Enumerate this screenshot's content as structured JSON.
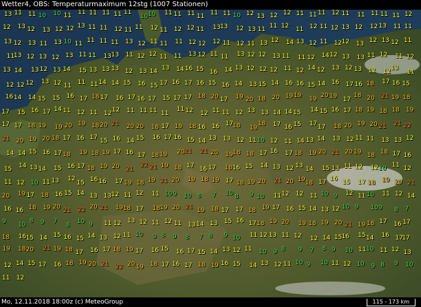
{
  "header": {
    "title": "Wetter4, OBS: Temperaturmaximum 12stg (1007 Stationen)"
  },
  "footer": {
    "text": "Mo, 12.11.2018 18:00z (c) MeteoGroup",
    "scale": "115 - 173 km"
  },
  "colors": {
    "warm": "#ffff33",
    "warmer": "#ffc020",
    "hot": "#ff8020",
    "cool": "#55e055",
    "sea": "#1e3850"
  },
  "stations": [
    "13",
    "11",
    "11",
    "10",
    "10",
    "11",
    "11",
    "11",
    "11",
    "11",
    "11",
    "10",
    "10",
    "11",
    "11",
    "11",
    "11",
    "11",
    "11",
    "10",
    "12",
    "13",
    "12",
    "12",
    "11",
    "11",
    "11",
    "12",
    "11",
    "11",
    "11",
    "11",
    "11",
    "12",
    "12",
    "13",
    "12",
    "13",
    "12",
    "12",
    "13",
    "11",
    "11",
    "12",
    "11",
    "11",
    "12",
    "11",
    "12",
    "12",
    "11",
    "13",
    "13",
    "12",
    "13",
    "11",
    "11",
    "12",
    "11",
    "12",
    "11",
    "12",
    "13",
    "12",
    "12",
    "13",
    "11",
    "11",
    "13",
    "12",
    "13",
    "11",
    "13",
    "10",
    "11",
    "11",
    "11",
    "11",
    "13",
    "12",
    "11",
    "11",
    "11",
    "12",
    "12",
    "12",
    "11",
    "12",
    "11",
    "13",
    "12",
    "14",
    "13",
    "12",
    "11",
    "12",
    "12",
    "13",
    "12",
    "13",
    "12",
    "11",
    "11",
    "13",
    "12",
    "13",
    "12",
    "13",
    "11",
    "11",
    "13",
    "13",
    "11",
    "12",
    "12",
    "11",
    "11",
    "13",
    "12",
    "11",
    "11",
    "13",
    "12",
    "12",
    "13",
    "11",
    "11",
    "12",
    "14",
    "12",
    "13",
    "13",
    "11",
    "12",
    "11",
    "12",
    "13",
    "14",
    "13",
    "12",
    "13",
    "14",
    "15",
    "13",
    "13",
    "13",
    "12",
    "13",
    "14",
    "13",
    "14",
    "16",
    "15",
    "16",
    "14",
    "13",
    "12",
    "12",
    "12",
    "11",
    "12",
    "14",
    "12",
    "13",
    "12",
    "13",
    "12",
    "12",
    "13",
    "11",
    "12",
    "12",
    "12",
    "13",
    "12",
    "11",
    "11",
    "11",
    "14",
    "14",
    "15",
    "16",
    "15",
    "17",
    "16",
    "17",
    "16",
    "15",
    "16",
    "14",
    "13",
    "15",
    "14",
    "16",
    "16",
    "15",
    "14",
    "16",
    "17",
    "16",
    "18",
    "17",
    "16",
    "15",
    "16",
    "14",
    "14",
    "15",
    "15",
    "16",
    "17",
    "18",
    "17",
    "16",
    "17",
    "16",
    "17",
    "15",
    "17",
    "17",
    "18",
    "20",
    "17",
    "19",
    "20",
    "18",
    "20",
    "19",
    "19",
    "19",
    "20",
    "19",
    "17",
    "18",
    "20",
    "21",
    "19",
    "18",
    "17",
    "15",
    "16",
    "17",
    "14",
    "11",
    "12",
    "11",
    "12",
    "12",
    "11",
    "11",
    "11",
    "11",
    "11",
    "12",
    "12",
    "11",
    "11",
    "12",
    "13",
    "13",
    "14",
    "14",
    "15",
    "14",
    "15",
    "16",
    "17",
    "18",
    "19",
    "18",
    "18",
    "19",
    "17",
    "17",
    "18",
    "19",
    "19",
    "20",
    "19",
    "18",
    "20",
    "21",
    "20",
    "20",
    "18",
    "17",
    "19",
    "18",
    "16",
    "16",
    "17",
    "18",
    "19",
    "18",
    "17",
    "16",
    "15",
    "17",
    "17",
    "18",
    "20",
    "19",
    "20",
    "21",
    "21",
    "22",
    "21",
    "20",
    "19",
    "20",
    "18",
    "17",
    "16",
    "17",
    "15",
    "16",
    "14",
    "15",
    "16",
    "17",
    "16",
    "15",
    "14",
    "13",
    "13",
    "12",
    "11",
    "10",
    "12",
    "11",
    "14",
    "13",
    "14",
    "13",
    "12",
    "11",
    "11",
    "13",
    "13",
    "12",
    "14",
    "14",
    "15",
    "16",
    "17",
    "18",
    "19",
    "18",
    "19",
    "17",
    "16",
    "17",
    "18",
    "19",
    "20",
    "21",
    "21",
    "20",
    "19",
    "18",
    "18",
    "17",
    "16",
    "17",
    "18",
    "19",
    "20",
    "21",
    "20",
    "19",
    "18",
    "18",
    "17",
    "16",
    "15",
    "14",
    "13",
    "14",
    "15",
    "16",
    "17",
    "18",
    "19",
    "20",
    "21",
    "22",
    "21",
    "19",
    "18",
    "17",
    "16",
    "17",
    "18",
    "16",
    "15",
    "14",
    "13",
    "12",
    "13",
    "14",
    "15",
    "13",
    "11",
    "12",
    "12",
    "10",
    "11",
    "12",
    "11",
    "12",
    "10",
    "11",
    "13",
    "12",
    "15",
    "16",
    "16",
    "17",
    "19",
    "18",
    "19",
    "21",
    "20",
    "19",
    "18",
    "19",
    "17",
    "18",
    "19",
    "20",
    "21",
    "20",
    "19",
    "18",
    "17",
    "16",
    "15",
    "17",
    "18",
    "19",
    "20",
    "21",
    "20",
    "19",
    "17",
    "18",
    "16",
    "15",
    "14",
    "13",
    "13",
    "12",
    "11",
    "12",
    "11",
    "10",
    "9",
    "10",
    "8",
    "7",
    "10",
    "8",
    "9",
    "10",
    "11",
    "12",
    "12",
    "11",
    "10",
    "9",
    "12",
    "11",
    "10",
    "11",
    "12",
    "14",
    "16",
    "16",
    "18",
    "19",
    "20",
    "21",
    "22",
    "20",
    "21",
    "19",
    "18",
    "17",
    "18",
    "19",
    "20",
    "21",
    "19",
    "18",
    "17",
    "17",
    "18",
    "19",
    "17",
    "16",
    "15",
    "14",
    "13",
    "12",
    "10",
    "9",
    "10",
    "9",
    "8",
    "7",
    "9",
    "10",
    "8",
    "9",
    "7",
    "8",
    "10",
    "9",
    "11",
    "12",
    "13",
    "12",
    "11",
    "12",
    "11",
    "13",
    "14",
    "13",
    "15",
    "16",
    "17",
    "18",
    "19",
    "20",
    "19",
    "18",
    "19",
    "20",
    "21",
    "19",
    "18",
    "17",
    "16",
    "17",
    "18",
    "16",
    "15",
    "14",
    "15",
    "16",
    "15",
    "14",
    "13",
    "12",
    "11",
    "10",
    "9",
    "8",
    "9",
    "8",
    "7",
    "8",
    "9",
    "10",
    "11",
    "12",
    "13",
    "11",
    "12",
    "12",
    "14",
    "15",
    "16",
    "15",
    "14",
    "16",
    "17",
    "17",
    "19",
    "18",
    "20",
    "21",
    "19",
    "18",
    "17",
    "16",
    "17",
    "18",
    "19",
    "17",
    "16",
    "15",
    "16",
    "17",
    "15",
    "14",
    "13",
    "12",
    "11",
    "10",
    "9",
    "8",
    "9",
    "7",
    "8",
    "9",
    "10",
    "11",
    "10",
    "11",
    "12",
    "13",
    "12",
    "14",
    "15",
    "17",
    "16",
    "18",
    "19",
    "20",
    "21",
    "22",
    "20",
    "19",
    "18",
    "17",
    "16",
    "17",
    "18",
    "19",
    "16",
    "15",
    "14",
    "13",
    "12",
    "11",
    "10",
    "9",
    "10",
    "11",
    "12",
    "10",
    "9",
    "8",
    "9",
    "10",
    "11",
    "12"
  ]
}
